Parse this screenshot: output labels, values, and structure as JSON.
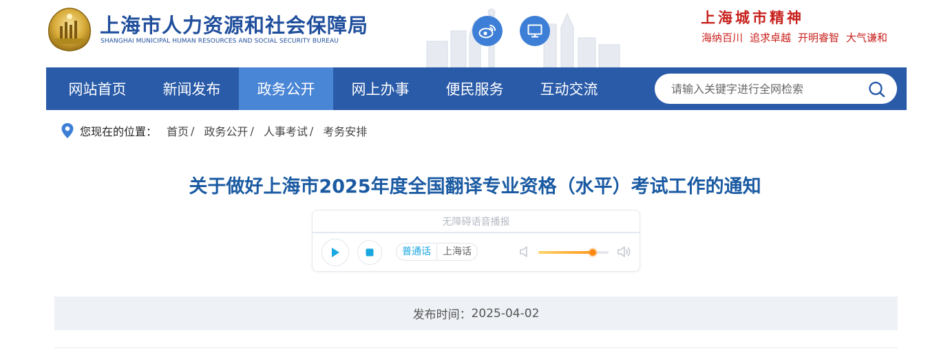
{
  "header": {
    "site_title": "上海市人力资源和社会保障局",
    "site_subtitle": "SHANGHAI MUNICIPAL HUMAN RESOURCES AND SOCIAL SECURITY BUREAU",
    "spirit_title": "上海城市精神",
    "spirit_words": [
      "海纳百川",
      "追求卓越",
      "开明睿智",
      "大气谦和"
    ],
    "weibo_icon": "weibo-icon",
    "pc_icon": "desktop-monitor-icon"
  },
  "nav": {
    "items": [
      {
        "label": "网站首页",
        "active": false
      },
      {
        "label": "新闻发布",
        "active": false
      },
      {
        "label": "政务公开",
        "active": true
      },
      {
        "label": "网上办事",
        "active": false
      },
      {
        "label": "便民服务",
        "active": false
      },
      {
        "label": "互动交流",
        "active": false
      }
    ],
    "search": {
      "placeholder": "请输入关键字进行全网检索",
      "value": ""
    }
  },
  "breadcrumb": {
    "label": "您现在的位置：",
    "items": [
      "首页",
      "政务公开",
      "人事考试",
      "考务安排"
    ],
    "separator": "/"
  },
  "article": {
    "title": "关于做好上海市2025年度全国翻译专业资格（水平）考试工作的通知",
    "publish_label": "发布时间：",
    "publish_date": "2025-04-02"
  },
  "player": {
    "caption": "无障碍语音播报",
    "lang_options": [
      "普通话",
      "上海话"
    ],
    "selected_lang": "普通话",
    "volume": 0.77
  },
  "colors": {
    "brand_blue": "#2a5ba8",
    "nav_active": "#4a86d6",
    "title_blue": "#1a5aa2",
    "spirit_red": "#c8211d",
    "player_accent": "#1aa7e0",
    "volume_orange": "#ff8a12"
  }
}
